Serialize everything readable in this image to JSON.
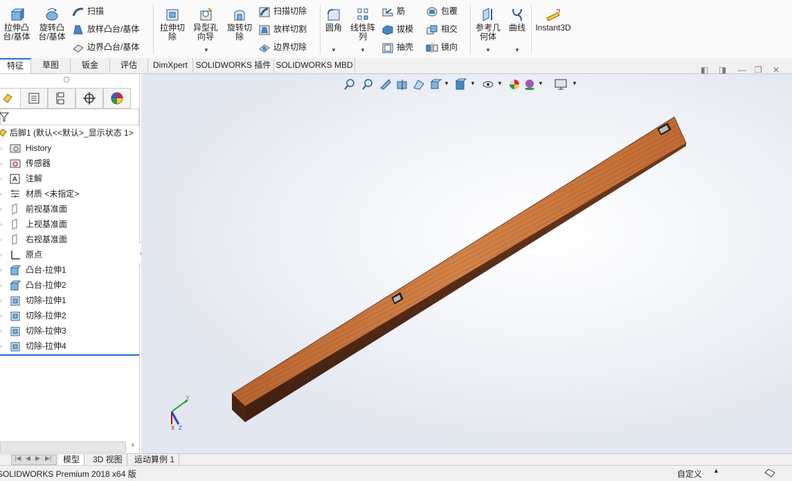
{
  "ribbon": {
    "extrude_boss": "拉伸凸\n台/基体",
    "revolve_boss": "旋转凸\n台/基体",
    "sweep": "扫描",
    "loft_boss": "放样凸台/基体",
    "boundary_boss": "边界凸台/基体",
    "extrude_cut": "拉伸切\n除",
    "hole_wizard": "异型孔\n向导",
    "revolve_cut": "旋转切\n除",
    "sweep_cut": "扫描切除",
    "loft_cut": "放样切割",
    "boundary_cut": "边界切除",
    "fillet": "圆角",
    "linear_pattern": "线性阵\n列",
    "rib": "筋",
    "draft": "拔模",
    "shell": "抽壳",
    "wrap": "包覆",
    "intersect": "相交",
    "mirror": "镜向",
    "reference_geometry": "参考几\n何体",
    "curves": "曲线",
    "instant3d": "Instant3D"
  },
  "tabs": [
    "特征",
    "草图",
    "钣金",
    "评估",
    "DimXpert",
    "SOLIDWORKS 插件",
    "SOLIDWORKS MBD"
  ],
  "tree": {
    "root": "后脚1  (默认<<默认>_显示状态 1>",
    "items": [
      "History",
      "传感器",
      "注解",
      "材质 <未指定>",
      "前视基准面",
      "上视基准面",
      "右视基准面",
      "原点",
      "凸台-拉伸1",
      "凸台-拉伸2",
      "切除-拉伸1",
      "切除-拉伸2",
      "切除-拉伸3",
      "切除-拉伸4"
    ]
  },
  "bottom_tabs": [
    "模型",
    "3D 视图",
    "运动算例 1"
  ],
  "status": {
    "app": "SOLIDWORKS Premium 2018 x64 版",
    "units": "自定义"
  },
  "colors": {
    "wood_top": "#c8743a",
    "wood_side": "#5a2e18",
    "accent": "#1f6fd6"
  }
}
